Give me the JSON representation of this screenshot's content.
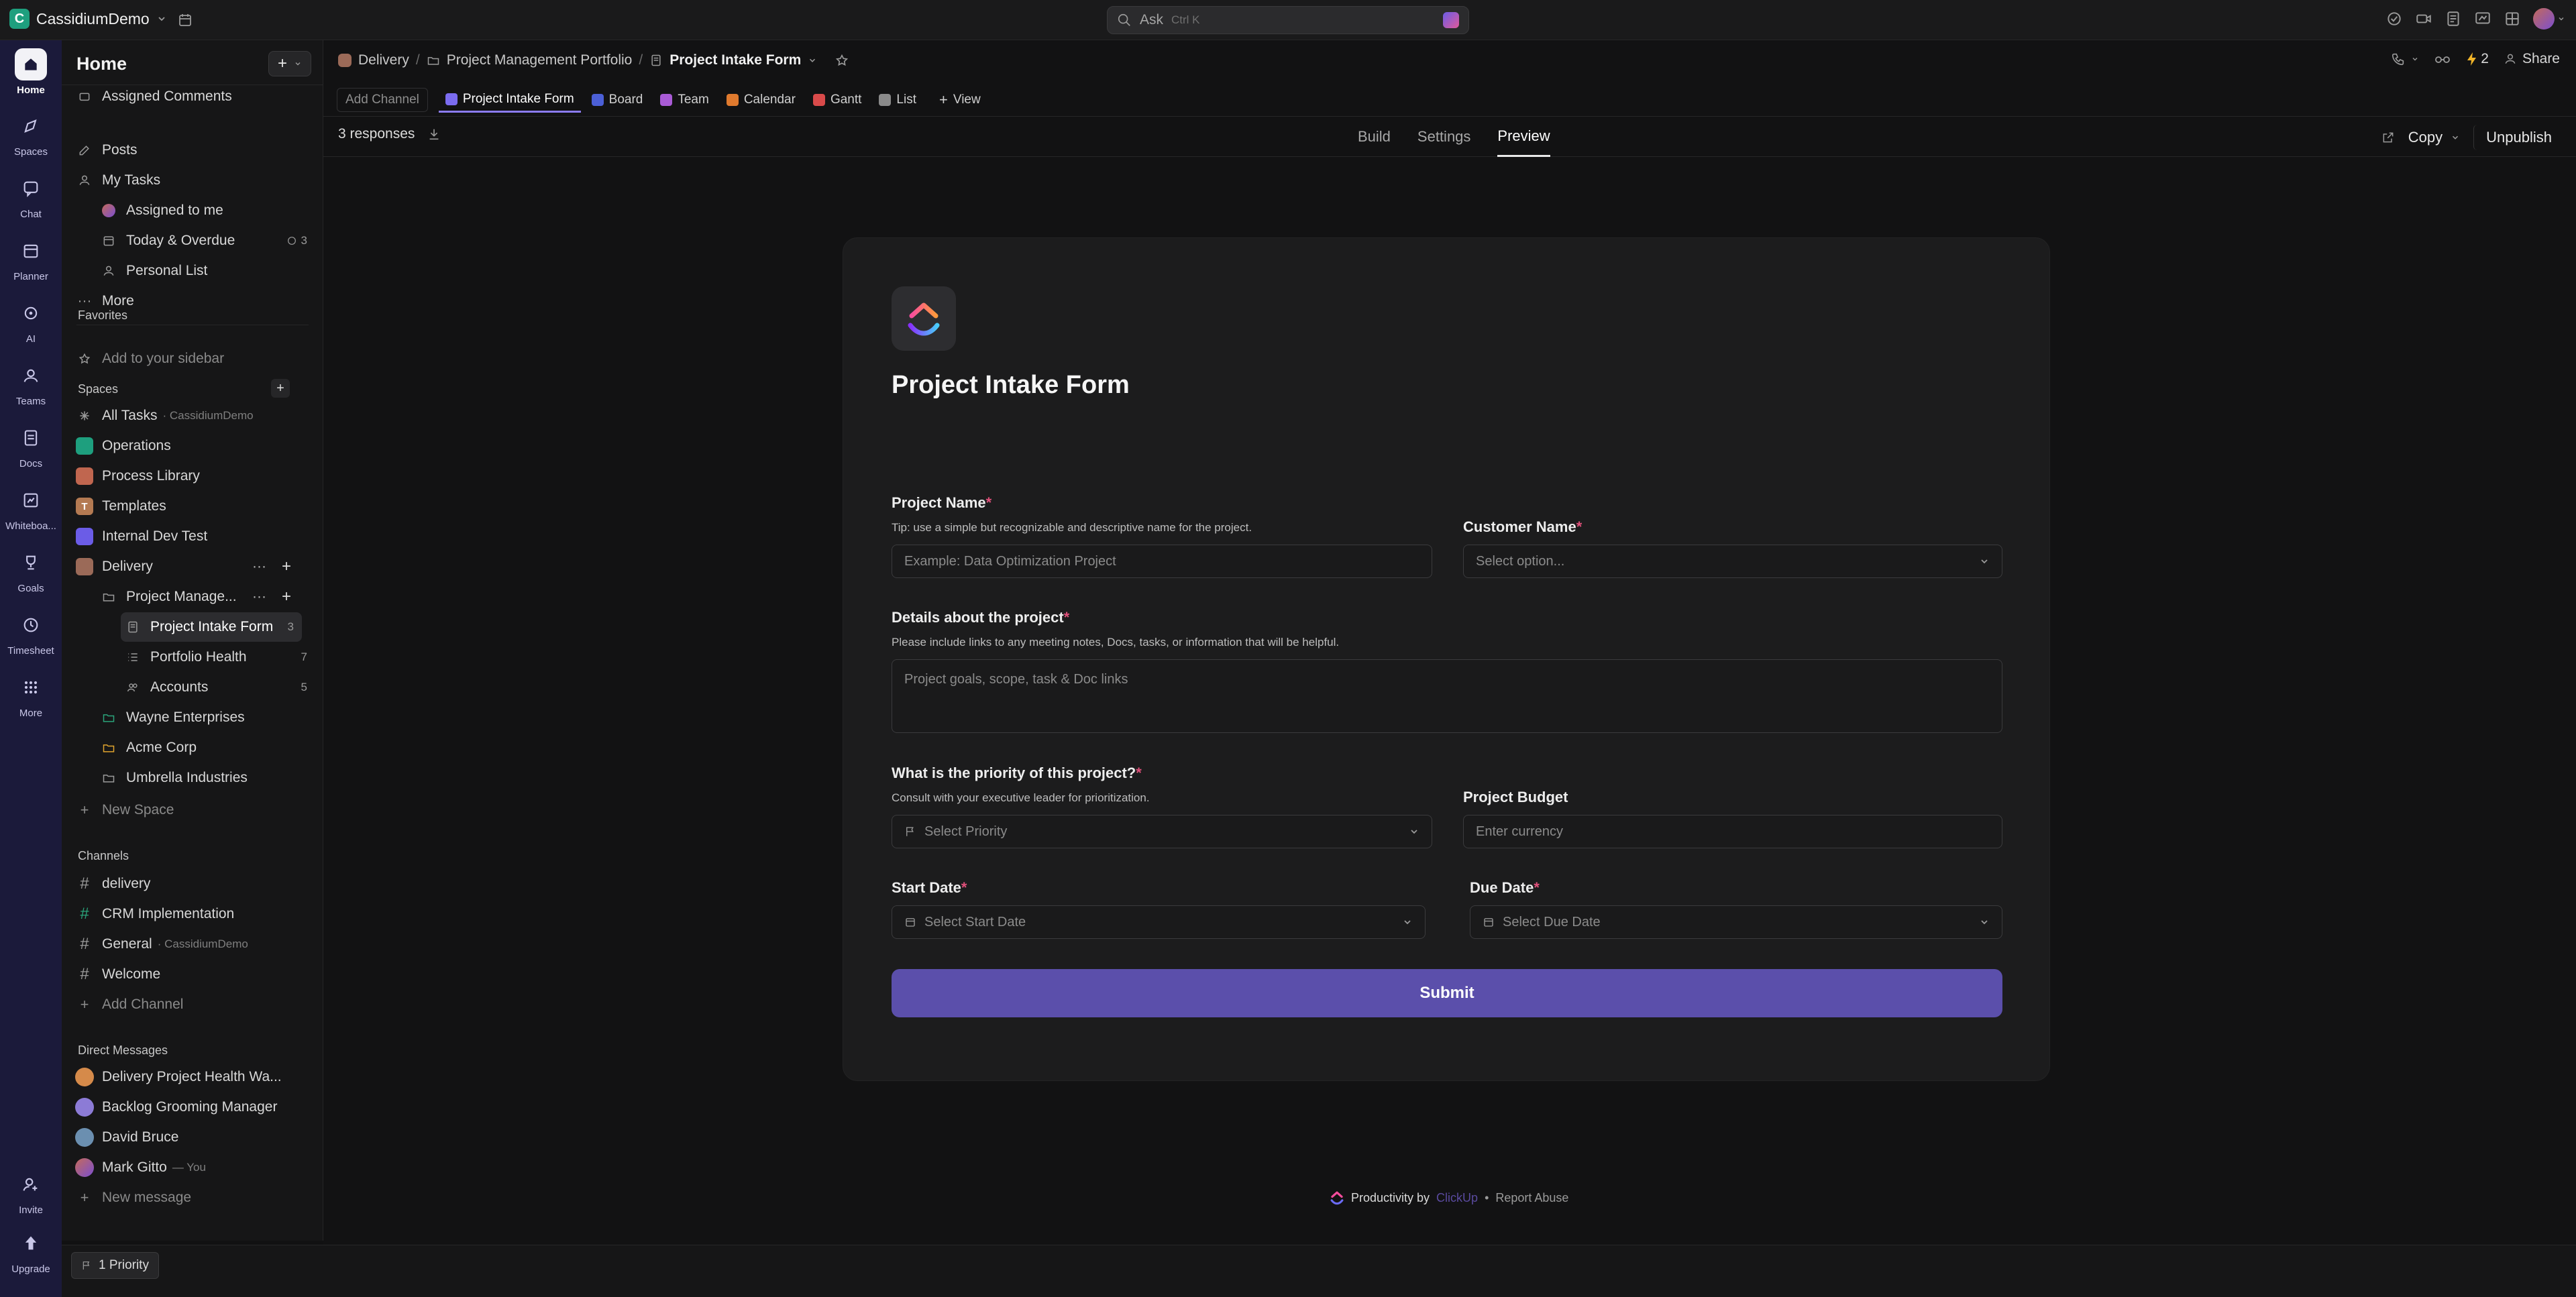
{
  "workspace": {
    "initial": "C",
    "name": "CassidiumDemo"
  },
  "search": {
    "placeholder": "Ask",
    "shortcut": "Ctrl K"
  },
  "topbar": {
    "automations_count": "2"
  },
  "rail": [
    {
      "label": "Home",
      "icon": "home-icon"
    },
    {
      "label": "Spaces",
      "icon": "spaces-icon"
    },
    {
      "label": "Chat",
      "icon": "chat-icon"
    },
    {
      "label": "Planner",
      "icon": "calendar-icon"
    },
    {
      "label": "AI",
      "icon": "ai-icon"
    },
    {
      "label": "Teams",
      "icon": "teams-icon"
    },
    {
      "label": "Docs",
      "icon": "docs-icon"
    },
    {
      "label": "Whiteboa...",
      "icon": "whiteboard-icon"
    },
    {
      "label": "Goals",
      "icon": "trophy-icon"
    },
    {
      "label": "Timesheet",
      "icon": "clock-icon"
    },
    {
      "label": "More",
      "icon": "grid-icon"
    },
    {
      "label": "Invite",
      "icon": "invite-icon"
    },
    {
      "label": "Upgrade",
      "icon": "upgrade-icon"
    }
  ],
  "sidebar": {
    "title": "Home",
    "top_items": [
      {
        "label": "Assigned Comments"
      },
      {
        "label": "Posts"
      },
      {
        "label": "My Tasks"
      },
      {
        "label": "Assigned to me"
      },
      {
        "label": "Today & Overdue",
        "count": "3"
      },
      {
        "label": "Personal List"
      },
      {
        "label": "More"
      }
    ],
    "favorites": {
      "heading": "Favorites",
      "placeholder": "Add to your sidebar"
    },
    "spaces": {
      "heading": "Spaces",
      "all_tasks": {
        "label": "All Tasks",
        "sub": "· CassidiumDemo"
      },
      "items": [
        {
          "label": "Operations",
          "color": "#1e9f7e",
          "initial": ""
        },
        {
          "label": "Process Library",
          "color": "#c0664f",
          "initial": ""
        },
        {
          "label": "Templates",
          "color": "#b47a52",
          "initial": "T"
        },
        {
          "label": "Internal Dev Test",
          "color": "#6b5ce7",
          "initial": ""
        },
        {
          "label": "Delivery",
          "color": "#9b6a58",
          "initial": ""
        }
      ],
      "folder": "Project Manage...",
      "lists": [
        {
          "label": "Project Intake Form",
          "count": "3"
        },
        {
          "label": "Portfolio Health",
          "count": "7"
        },
        {
          "label": "Accounts",
          "count": "5"
        }
      ],
      "folders": [
        {
          "label": "Wayne Enterprises",
          "color": "#2aa37a"
        },
        {
          "label": "Acme Corp",
          "color": "#e0a32e"
        },
        {
          "label": "Umbrella Industries",
          "color": "#9a9a9a"
        }
      ],
      "new_space": "New Space"
    },
    "channels": {
      "heading": "Channels",
      "items": [
        {
          "label": "delivery",
          "sub": ""
        },
        {
          "label": "CRM Implementation",
          "sub": ""
        },
        {
          "label": "General",
          "sub": "· CassidiumDemo"
        },
        {
          "label": "Welcome",
          "sub": ""
        }
      ],
      "add": "Add Channel"
    },
    "dms": {
      "heading": "Direct Messages",
      "items": [
        {
          "label": "Delivery Project Health Wa...",
          "sub": ""
        },
        {
          "label": "Backlog Grooming Manager",
          "sub": ""
        },
        {
          "label": "David Bruce",
          "sub": ""
        },
        {
          "label": "Mark Gitto",
          "sub": "— You"
        }
      ],
      "new": "New message"
    }
  },
  "statusbar": {
    "priority_chip": "1 Priority"
  },
  "breadcrumb": {
    "space": "Delivery",
    "folder": "Project Management Portfolio",
    "current": "Project Intake Form"
  },
  "header_right": {
    "share": "Share"
  },
  "views": {
    "add_channel": "Add Channel",
    "items": [
      {
        "label": "Project Intake Form",
        "color": "#7b6cf0"
      },
      {
        "label": "Board",
        "color": "#4b5fd6"
      },
      {
        "label": "Team",
        "color": "#a95bd6"
      },
      {
        "label": "Calendar",
        "color": "#e07a2e"
      },
      {
        "label": "Gantt",
        "color": "#d94a4a"
      },
      {
        "label": "List",
        "color": "#8a8a8a"
      }
    ],
    "add_view": "View"
  },
  "toolbar": {
    "responses": "3 responses",
    "tabs": [
      "Build",
      "Settings",
      "Preview"
    ],
    "copy": "Copy",
    "unpublish": "Unpublish"
  },
  "form": {
    "title": "Project Intake Form",
    "project_name": {
      "label": "Project Name",
      "hint": "Tip: use a simple but recognizable and descriptive name for the project.",
      "placeholder": "Example: Data Optimization Project"
    },
    "customer_name": {
      "label": "Customer Name",
      "placeholder": "Select option..."
    },
    "details": {
      "label": "Details about the project",
      "hint": "Please include links to any meeting notes, Docs, tasks, or information that will be helpful.",
      "placeholder": "Project goals, scope, task & Doc links"
    },
    "priority": {
      "label": "What is the priority of this project?",
      "hint": "Consult with your executive leader for prioritization.",
      "placeholder": "Select Priority"
    },
    "budget": {
      "label": "Project Budget",
      "placeholder": "Enter currency"
    },
    "start_date": {
      "label": "Start Date",
      "placeholder": "Select Start Date"
    },
    "due_date": {
      "label": "Due Date",
      "placeholder": "Select Due Date"
    },
    "required_mark": "*",
    "submit": "Submit"
  },
  "footer": {
    "productivity": "Productivity by",
    "brand": "ClickUp",
    "sep": "•",
    "report": "Report Abuse"
  },
  "colors": {
    "accent": "#5b4fab",
    "rail": "#1b1a3a",
    "required": "#e0507a"
  }
}
